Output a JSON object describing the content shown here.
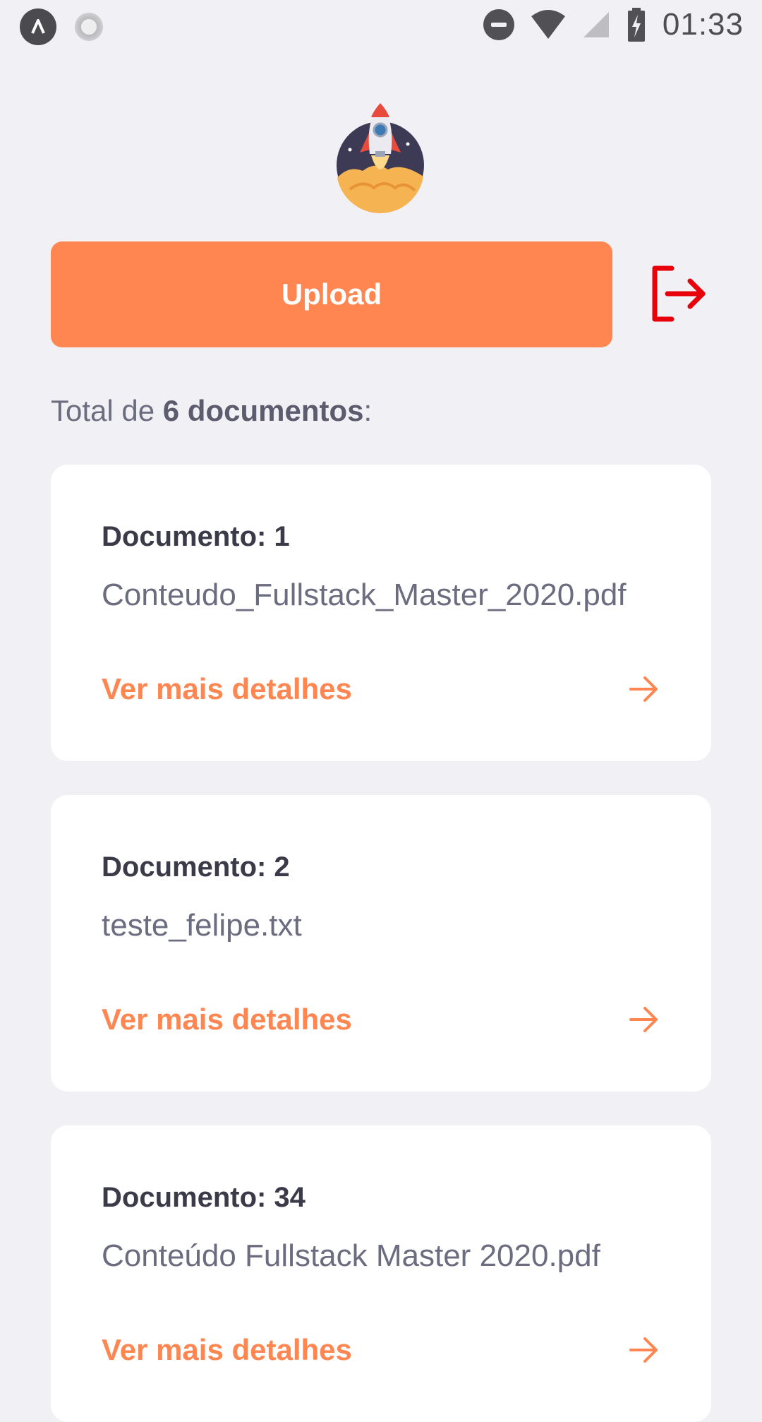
{
  "status_bar": {
    "time": "01:33"
  },
  "header": {
    "logo_icon": "rocket-logo-icon",
    "upload_label": "Upload",
    "logout_icon": "logout-icon"
  },
  "summary": {
    "prefix": "Total de ",
    "count_label": "6 documentos",
    "suffix": ":"
  },
  "documents": [
    {
      "title": "Documento: 1",
      "filename": "Conteudo_Fullstack_Master_2020.pdf",
      "link_label": "Ver mais detalhes"
    },
    {
      "title": "Documento: 2",
      "filename": "teste_felipe.txt",
      "link_label": "Ver mais detalhes"
    },
    {
      "title": "Documento: 34",
      "filename": "Conteúdo Fullstack Master 2020.pdf",
      "link_label": "Ver mais detalhes"
    }
  ],
  "colors": {
    "accent": "#ff8651",
    "logout": "#e8000b",
    "background": "#f0f0f5",
    "title_text": "#3a3a48",
    "secondary_text": "#6c6c80"
  }
}
